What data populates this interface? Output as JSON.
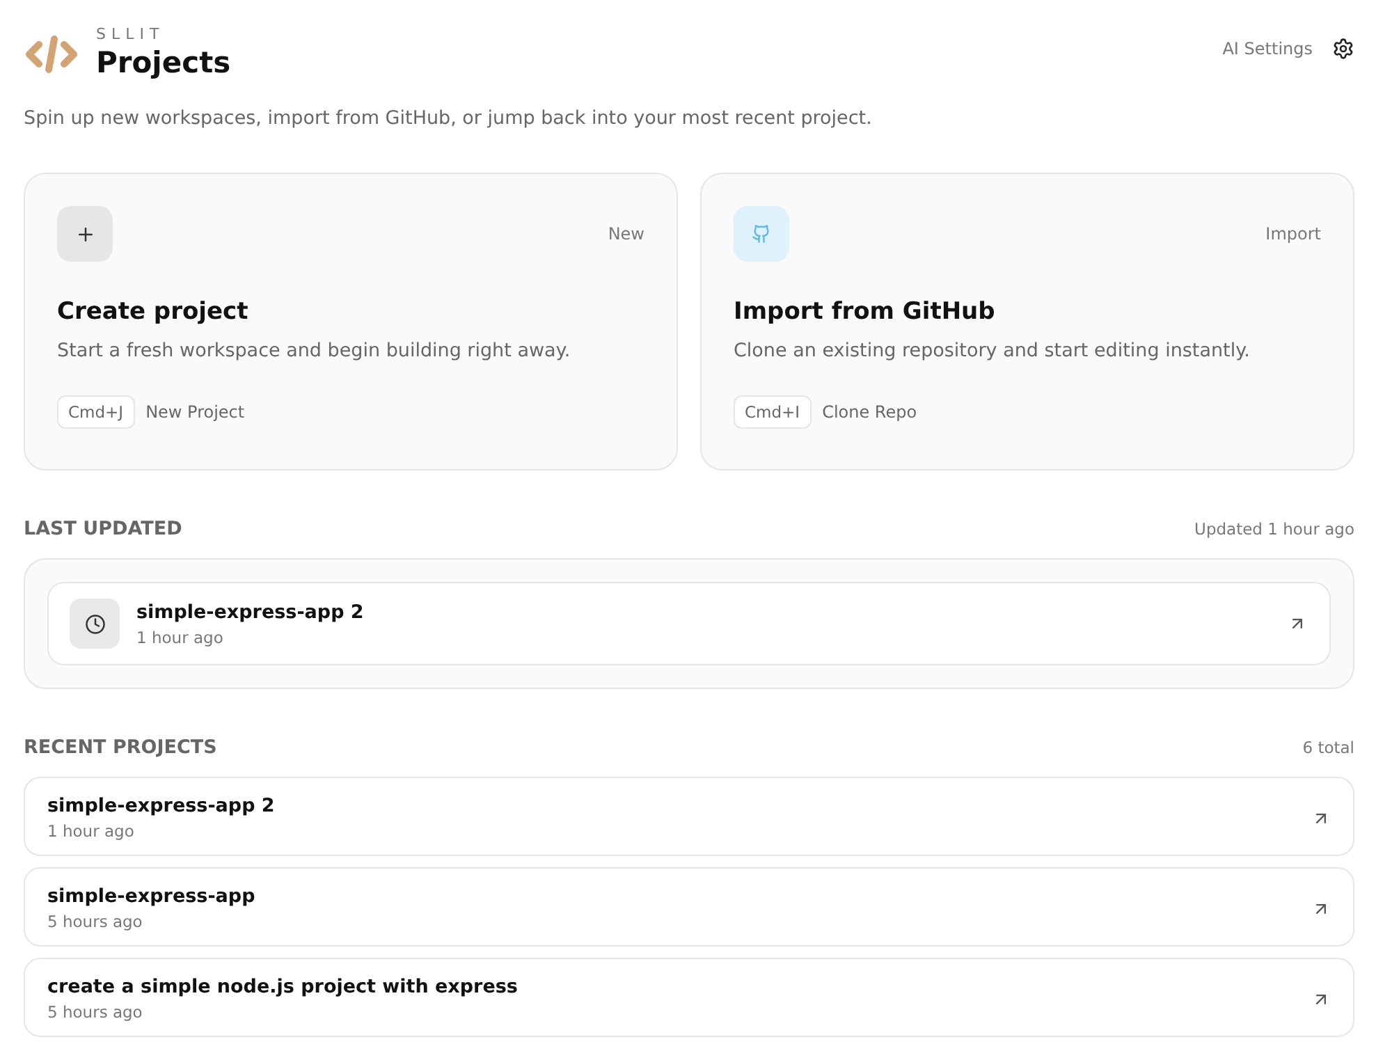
{
  "brand": {
    "name": "SLLIT",
    "title": "Projects"
  },
  "subtitle": "Spin up new workspaces, import from GitHub, or jump back into your most recent project.",
  "settings": {
    "label": "AI Settings"
  },
  "actions": [
    {
      "kind": "create",
      "tag": "New",
      "title": "Create project",
      "description": "Start a fresh workspace and begin building right away.",
      "shortcut": "Cmd+J",
      "shortcut_label": "New Project"
    },
    {
      "kind": "github",
      "tag": "Import",
      "title": "Import from GitHub",
      "description": "Clone an existing repository and start editing instantly.",
      "shortcut": "Cmd+I",
      "shortcut_label": "Clone Repo"
    }
  ],
  "last_updated": {
    "heading": "LAST UPDATED",
    "meta": "Updated 1 hour ago",
    "project": {
      "name": "simple-express-app 2",
      "time": "1 hour ago"
    }
  },
  "recent": {
    "heading": "RECENT PROJECTS",
    "meta": "6 total",
    "projects": [
      {
        "name": "simple-express-app 2",
        "time": "1 hour ago"
      },
      {
        "name": "simple-express-app",
        "time": "5 hours ago"
      },
      {
        "name": "create a simple node.js project with express",
        "time": "5 hours ago"
      }
    ]
  }
}
